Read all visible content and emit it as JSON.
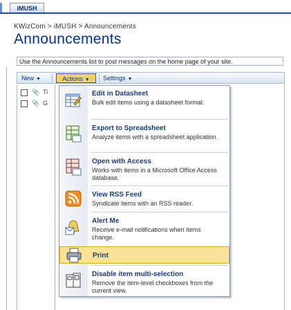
{
  "top_tab": {
    "label": "iMUSH"
  },
  "breadcrumb": "KWizCom > iMUSH > Announcements",
  "page_title": "Announcements",
  "description": "Use the Announcements list to post messages on the home page of your site.",
  "toolbar": {
    "new_label": "New",
    "actions_label": "Actions",
    "settings_label": "Settings"
  },
  "list": {
    "rows": [
      {
        "text": "Ti"
      },
      {
        "text": "G"
      }
    ]
  },
  "menu": {
    "items": [
      {
        "title": "Edit in Datasheet",
        "description": "Bulk edit items using a datasheet format.",
        "icon": "datasheet-icon"
      },
      {
        "title": "Export to Spreadsheet",
        "description": "Analyze items with a spreadsheet application.",
        "icon": "spreadsheet-icon"
      },
      {
        "title": "Open with Access",
        "description": "Works with items in a Microsoft Office Access database.",
        "icon": "access-icon"
      },
      {
        "title": "View RSS Feed",
        "description": "Syndicate items with an RSS reader.",
        "icon": "rss-icon"
      },
      {
        "title": "Alert Me",
        "description": "Receive e-mail notifications when items change.",
        "icon": "alert-bell-icon"
      },
      {
        "title": "Print",
        "description": "",
        "icon": "print-icon",
        "highlighted": true
      },
      {
        "title": "Disable item multi-selection",
        "description": "Remove the item-level checkboxes from the current view.",
        "icon": "disable-selection-icon"
      }
    ]
  },
  "colors": {
    "title_blue": "#003399",
    "highlight": "#fbe39a",
    "rss_orange": "#f28c1c"
  }
}
